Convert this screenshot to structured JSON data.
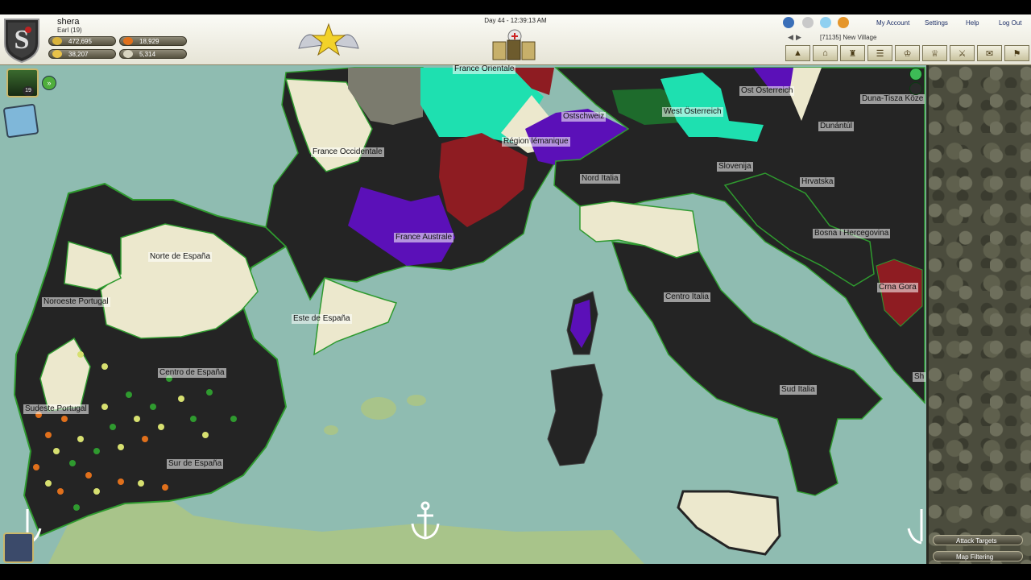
{
  "player": {
    "name": "shera",
    "rank": "Earl (19)"
  },
  "resources": {
    "silver": "472,695",
    "food": "18,929",
    "gold": "38,207",
    "honor": "5,314"
  },
  "header": {
    "day_time": "Day 44 - 12:39:13 AM",
    "village": "[71135] New Village",
    "links": [
      "My Account",
      "Settings",
      "Help",
      "Log Out"
    ]
  },
  "overlay": {
    "cards_badge": "19"
  },
  "map": {
    "regions": [
      "France Orientale",
      "Ost Österreich",
      "Duna-Tisza Köze",
      "Ostschweiz",
      "West Österreich",
      "Région lémanique",
      "Dunántúl",
      "France Occidentale",
      "Slovenija",
      "Nord Italia",
      "Hrvatska",
      "Norte de España",
      "France Australe",
      "Bosna i Hercegovina",
      "Noroeste Portugal",
      "Crna Gora",
      "Centro Italia",
      "Este de España",
      "Centro de España",
      "Sh",
      "Sudeste Portugal",
      "Sud Italia",
      "Sur de España"
    ]
  },
  "panel": {
    "buttons": [
      "Attack Targets",
      "Map Filtering"
    ]
  },
  "icons": [
    "shield-crest-icon",
    "crown-icon",
    "food-icon",
    "gold-icon",
    "quill-icon",
    "globe-icon",
    "cloud-icon",
    "chat-icon",
    "coin-icon",
    "anchor-icon",
    "cards-icon",
    "book-icon",
    "portrait-icon",
    "play-icon"
  ],
  "colors": {
    "sea": "#8fbcb1",
    "own_territory": "#242424",
    "neutral": "#ece8cd",
    "purple_faction": "#5b10b8",
    "red_faction": "#8e1c22",
    "teal_faction": "#1ee0b0",
    "green_border": "#2f9a2f"
  }
}
